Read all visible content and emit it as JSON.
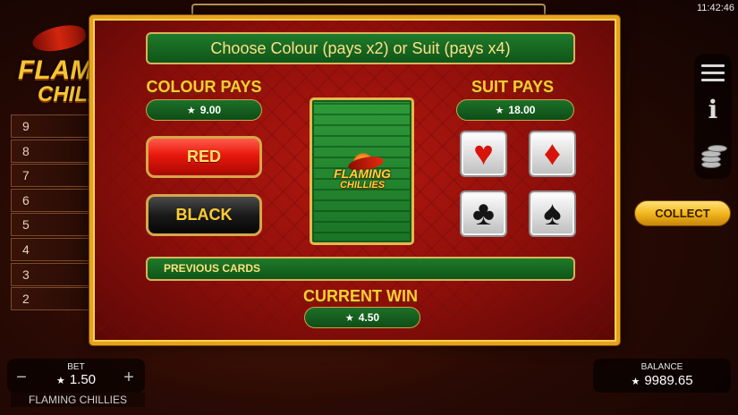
{
  "status_bar": {
    "time": "11:42:46"
  },
  "background": {
    "logo": {
      "line1": "FLAMING",
      "line2": "CHILLIES"
    },
    "ladder": [
      "9",
      "8",
      "7",
      "6",
      "5",
      "4",
      "3",
      "2"
    ]
  },
  "gamble": {
    "title": "Choose Colour (pays x2) or Suit (pays x4)",
    "colour_heading": "COLOUR PAYS",
    "colour_pays": "9.00",
    "suit_heading": "SUIT PAYS",
    "suit_pays": "18.00",
    "red_label": "RED",
    "black_label": "BLACK",
    "card_logo": {
      "line1": "FLAMING",
      "line2": "CHILLIES"
    },
    "suits": [
      {
        "name": "hearts",
        "glyph": "♥",
        "color": "#d8140a"
      },
      {
        "name": "diamonds",
        "glyph": "♦",
        "color": "#d8140a"
      },
      {
        "name": "clubs",
        "glyph": "♣",
        "color": "#151515"
      },
      {
        "name": "spades",
        "glyph": "♠",
        "color": "#151515"
      }
    ],
    "previous_cards_label": "PREVIOUS CARDS",
    "current_win_heading": "CURRENT WIN",
    "current_win": "4.50"
  },
  "side_controls": {
    "menu_icon": "menu-icon",
    "info_icon": "info-icon",
    "coins_icon": "coins-icon",
    "collect_label": "COLLECT"
  },
  "bottom": {
    "bet_label": "BET",
    "bet_value": "1.50",
    "bet_minus": "−",
    "bet_plus": "+",
    "game_name": "FLAMING CHILLIES",
    "balance_label": "BALANCE",
    "balance_value": "9989.65"
  },
  "colors": {
    "panel_border": "#e6a21f",
    "heading": "#ffcc33",
    "green_bar": "#1f7a2a",
    "red_button": "#e8180c"
  }
}
